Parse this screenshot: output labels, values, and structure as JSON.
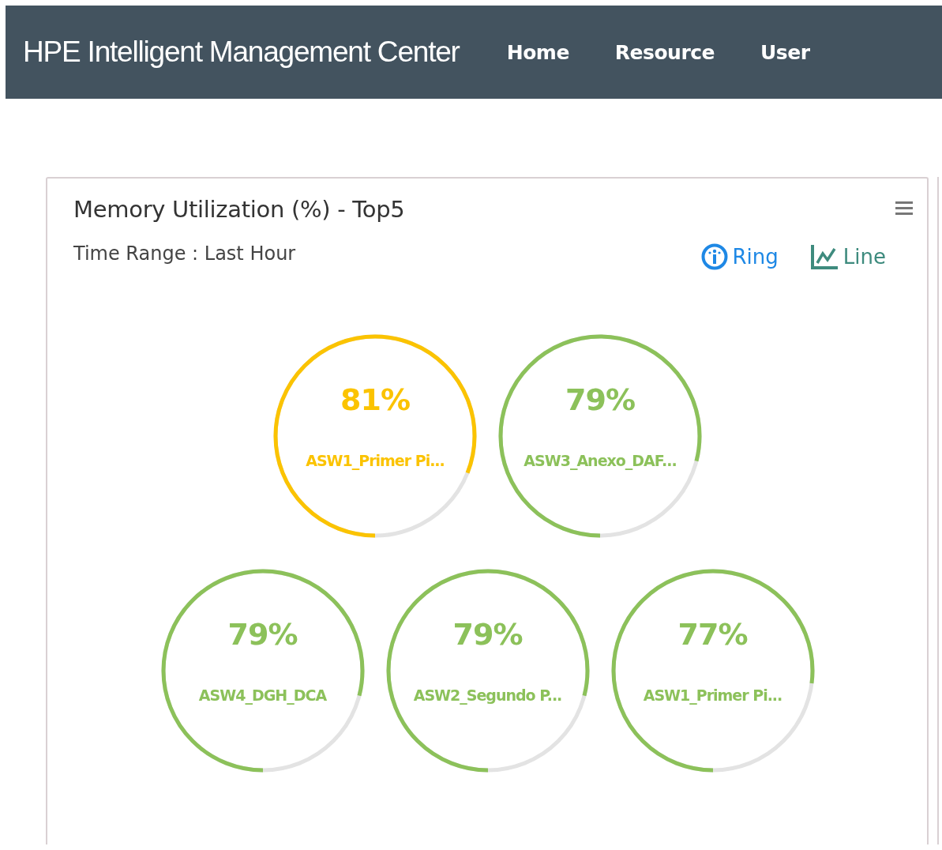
{
  "header": {
    "title": "HPE Intelligent Management Center",
    "nav": [
      {
        "label": "Home"
      },
      {
        "label": "Resource"
      },
      {
        "label": "User"
      }
    ]
  },
  "card": {
    "title": "Memory Utilization (%) - Top5",
    "time_range": "Time Range : Last Hour",
    "views": [
      {
        "kind": "ring",
        "label": "Ring"
      },
      {
        "kind": "line",
        "label": "Line"
      }
    ],
    "ring_rows": [
      [
        {
          "value": "81%",
          "name": "ASW1_Primer Pi...",
          "level": 0.81,
          "color": "#fbc300"
        },
        {
          "value": "79%",
          "name": "ASW3_Anexo_DAF...",
          "level": 0.79,
          "color": "#8cc15a"
        }
      ],
      [
        {
          "value": "79%",
          "name": "ASW4_DGH_DCA",
          "level": 0.79,
          "color": "#8cc15a"
        },
        {
          "value": "79%",
          "name": "ASW2_Segundo P...",
          "level": 0.79,
          "color": "#8cc15a"
        },
        {
          "value": "77%",
          "name": "ASW1_Primer Pi...",
          "level": 0.77,
          "color": "#8cc15a"
        }
      ]
    ]
  }
}
